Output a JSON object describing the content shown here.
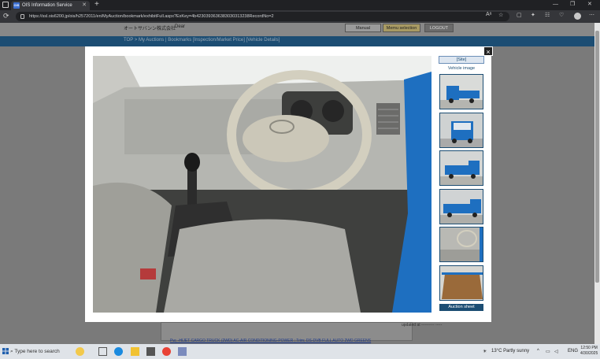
{
  "browser": {
    "tab_title": "OIS Information Service",
    "tab_favicon": "OIS",
    "url": "https://ssl.ois6200.jp/ois/h2572011/en/MyAuction/bookmark/exhibitFull.aspx?ExKey=4b4230393636383030313238RecordNo=2"
  },
  "page": {
    "site_name": "オートサバンン株式会社",
    "user_label": "Dear",
    "buttons": [
      "Manual",
      "Memu selection",
      "LOGOUT"
    ],
    "breadcrumb": "TOP > My Auctions | Bookmarks [Inspection/Market Price] [Vehicle Details]",
    "bid_text": "updated at ---------- -----",
    "features_link": "Pw; -HIJET CARGO TRUCK (2WD) AC-AIR CONDITIONING-POWER ; Trim; DS-DVB FULL AUTO 2WD GREENS"
  },
  "modal": {
    "site_tag": "[Site]",
    "vehicle_image_label": "Vehicle image",
    "auction_sheet_label": "Auction sheet",
    "close_label": "×",
    "thumbnails": [
      {
        "name": "thumb-front-angle"
      },
      {
        "name": "thumb-front"
      },
      {
        "name": "thumb-rear-angle"
      },
      {
        "name": "thumb-side"
      },
      {
        "name": "thumb-interior"
      },
      {
        "name": "thumb-cargo-bed"
      }
    ]
  },
  "taskbar": {
    "search_placeholder": "Type here to search",
    "weather": "13°C  Partly sunny",
    "language": "ENG",
    "time": "12:50 PM",
    "date": "4/30/2025"
  },
  "colors": {
    "accent": "#1c4d73",
    "truck_blue": "#1e6fc0",
    "interior_grey": "#a9a9a4"
  }
}
